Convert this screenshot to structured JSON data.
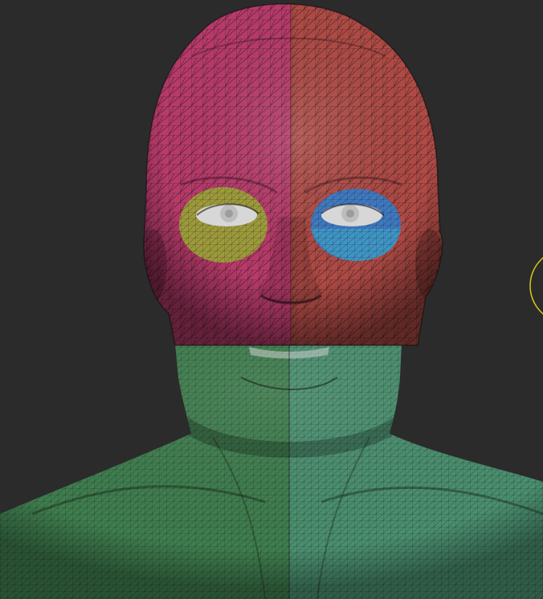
{
  "viewport": {
    "background": "#2b2b2b"
  },
  "polygroups": [
    {
      "name": "scalp-face-left",
      "color": "#b83a6a"
    },
    {
      "name": "scalp-face-right",
      "color": "#b04a45"
    },
    {
      "name": "eye-socket-left",
      "color": "#9d9a3c"
    },
    {
      "name": "eye-socket-right",
      "color": "#3f79c0"
    },
    {
      "name": "lower-face-neck-left",
      "color": "#3f7e4e"
    },
    {
      "name": "lower-face-neck-right",
      "color": "#4a8f6f"
    }
  ],
  "brush_cursor": {
    "icon": "brush-circle-icon",
    "color": "#d8c81a"
  },
  "wireframe": {
    "color": "#1a1a1a",
    "enabled": true
  }
}
